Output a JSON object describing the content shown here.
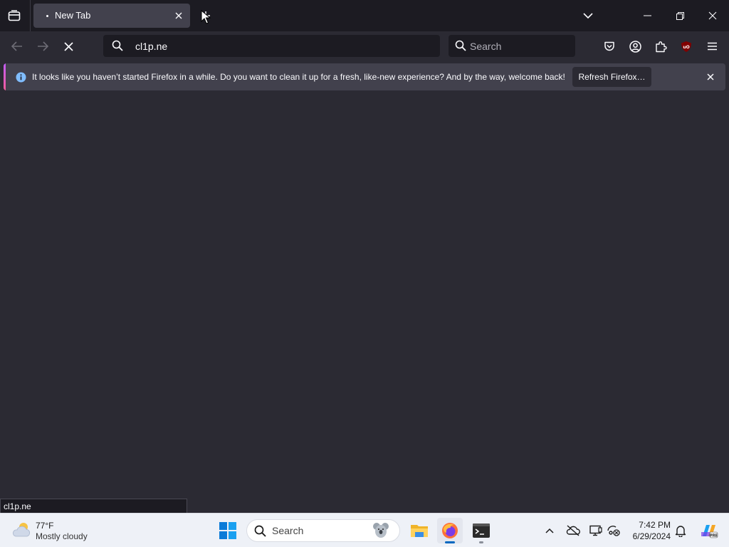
{
  "browser": {
    "tab": {
      "title": "New Tab"
    },
    "url_text": "cl1p.ne",
    "search_placeholder": "Search",
    "notification": {
      "message": "It looks like you haven’t started Firefox in a while. Do you want to clean it up for a fresh, like-new experience? And by the way, welcome back!",
      "button_label": "Refresh Firefox…"
    },
    "status_text": "cl1p.ne",
    "icons": {
      "tab_list": "tab-list-icon",
      "new_tab": "plus-icon",
      "all_tabs": "chevron-down-icon",
      "back": "arrow-left-icon",
      "forward": "arrow-right-icon",
      "stop": "close-icon",
      "pocket": "pocket-icon",
      "account": "account-icon",
      "extensions": "puzzle-icon",
      "ublock": "ublock-icon",
      "menu": "hamburger-icon"
    }
  },
  "taskbar": {
    "weather": {
      "temp": "77°F",
      "desc": "Mostly cloudy"
    },
    "search_label": "Search",
    "clock": {
      "time": "7:42 PM",
      "date": "6/29/2024"
    }
  },
  "colors": {
    "chrome_dark": "#1c1b22",
    "toolbar": "#2b2a33",
    "notification_bg": "#42414d",
    "taskbar_bg": "#eef1f7",
    "accent_blue": "#0067c0"
  }
}
